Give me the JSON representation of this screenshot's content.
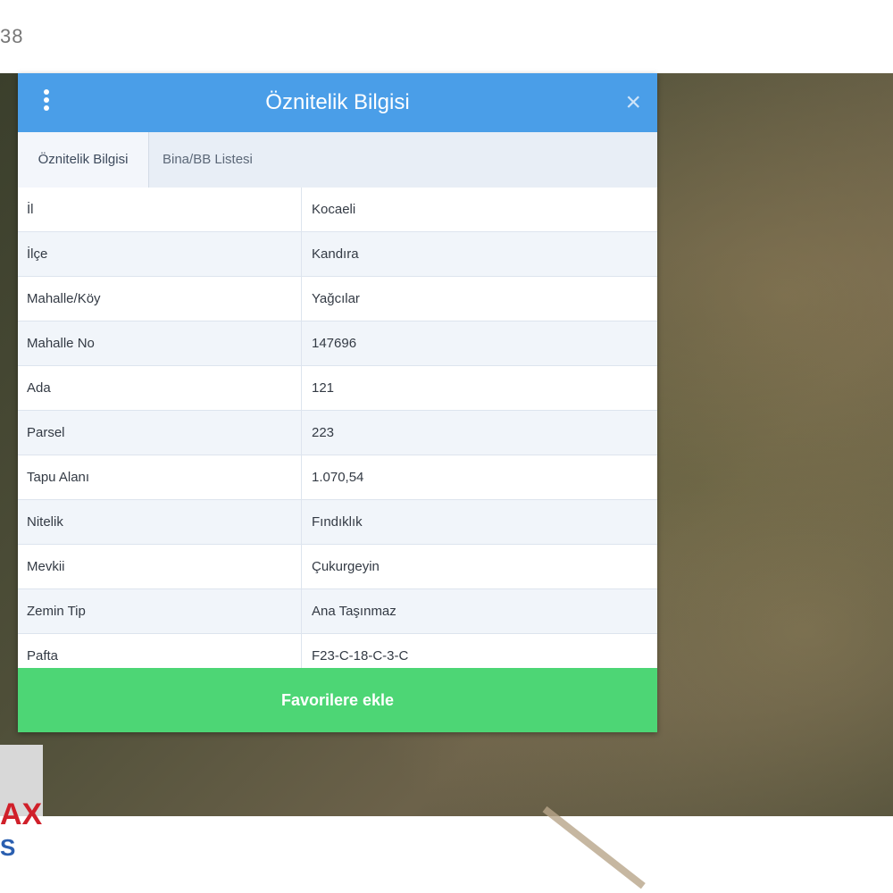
{
  "page": {
    "top_fragment": "38"
  },
  "dialog": {
    "title": "Öznitelik Bilgisi",
    "menu_icon": "kebab-menu-icon",
    "close_icon": "close-icon",
    "close_glyph": "×",
    "tabs": [
      {
        "label": "Öznitelik Bilgisi",
        "active": true
      },
      {
        "label": "Bina/BB Listesi",
        "active": false
      }
    ],
    "rows": [
      {
        "label": "İl",
        "value": "Kocaeli"
      },
      {
        "label": "İlçe",
        "value": "Kandıra"
      },
      {
        "label": "Mahalle/Köy",
        "value": "Yağcılar"
      },
      {
        "label": "Mahalle No",
        "value": "147696"
      },
      {
        "label": "Ada",
        "value": "121"
      },
      {
        "label": "Parsel",
        "value": "223"
      },
      {
        "label": "Tapu Alanı",
        "value": "1.070,54"
      },
      {
        "label": "Nitelik",
        "value": "Fındıklık"
      },
      {
        "label": "Mevkii",
        "value": "Çukurgeyin"
      },
      {
        "label": "Zemin Tip",
        "value": "Ana Taşınmaz"
      },
      {
        "label": "Pafta",
        "value": "F23-C-18-C-3-C"
      }
    ],
    "favorite_button": "Favorilere ekle"
  },
  "logo": {
    "line1": "AX",
    "line2": "S"
  },
  "colors": {
    "header": "#4a9ee8",
    "button": "#4dd675",
    "logo_red": "#d0202a",
    "logo_blue": "#2a5fb0"
  }
}
